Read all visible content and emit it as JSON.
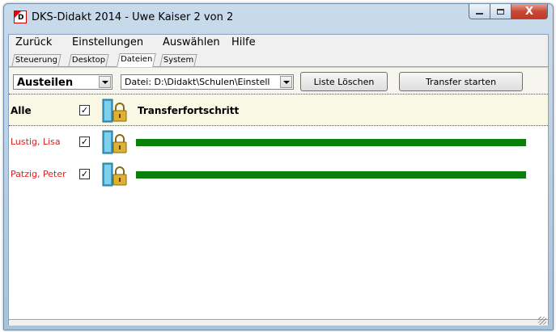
{
  "window": {
    "title": "DKS-Didakt 2014 - Uwe Kaiser  2 von 2",
    "app_icon_letter": "D",
    "close_glyph": "X"
  },
  "menu": [
    {
      "label": "Zurück"
    },
    {
      "label": "Einstellungen"
    },
    {
      "label": "Auswählen"
    },
    {
      "label": "Hilfe"
    }
  ],
  "tabs": [
    {
      "label": "Steuerung",
      "active": false
    },
    {
      "label": "Desktop",
      "active": false
    },
    {
      "label": "Dateien",
      "active": true
    },
    {
      "label": "System",
      "active": false
    }
  ],
  "toolbar": {
    "mode_value": "Austeilen",
    "file_value": "Datei: D:\\Didakt\\Schulen\\Einstell",
    "clear_button": "Liste Löschen",
    "transfer_button": "Transfer starten"
  },
  "list": {
    "header": {
      "name": "Alle",
      "checked": "✓",
      "column_title": "Transferfortschritt"
    },
    "rows": [
      {
        "name": "Lustig, Lisa",
        "checked": "✓",
        "progress": 1.0
      },
      {
        "name": "Patzig, Peter",
        "checked": "✓",
        "progress": 1.0
      }
    ]
  },
  "colors": {
    "progress_fill": "#0a7f0a",
    "student_name": "#e02020",
    "header_bg": "#f8f8e4"
  },
  "icons": {
    "folder": "locked-folder-icon",
    "window_minimize": "minimize-icon",
    "window_maximize": "maximize-icon",
    "window_close": "close-icon",
    "dropdown": "chevron-down-icon"
  }
}
